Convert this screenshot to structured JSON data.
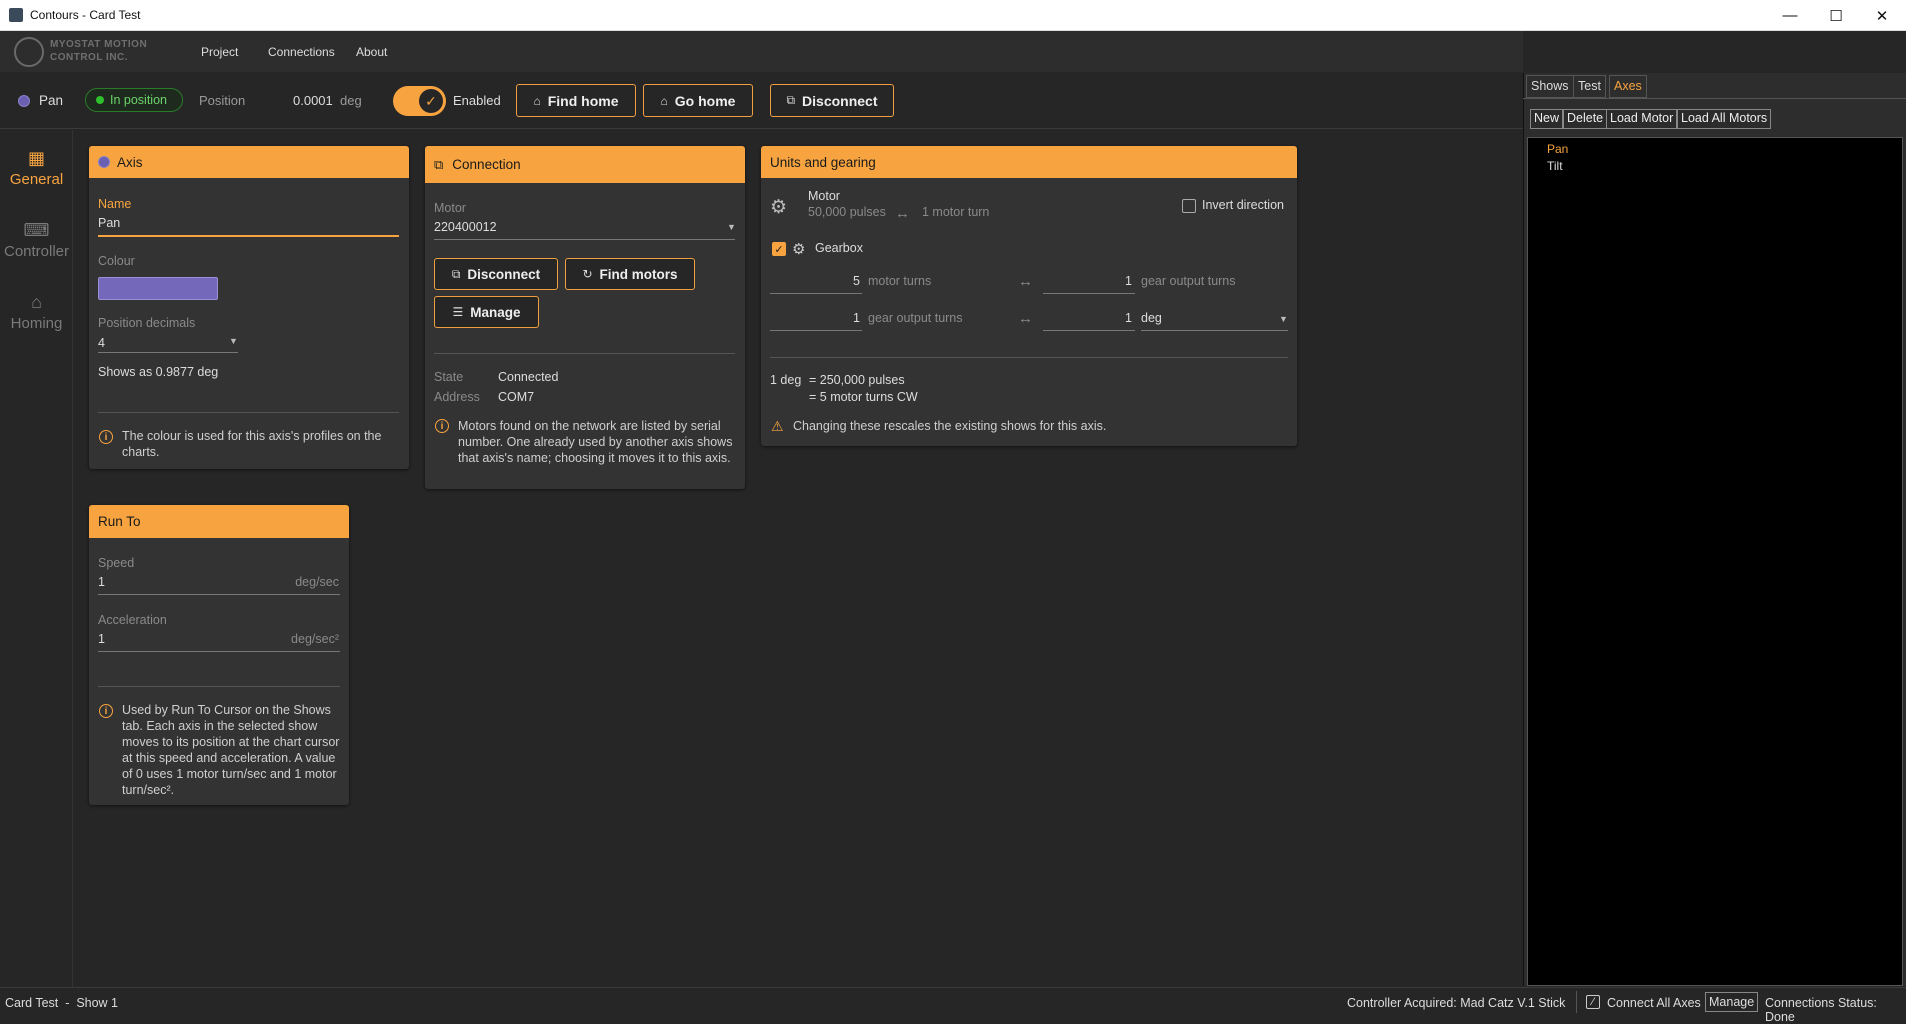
{
  "window": {
    "title": "Contours - Card Test",
    "min": "—",
    "max": "☐",
    "close": "✕"
  },
  "logo": {
    "line1": "MYOSTAT MOTION",
    "line2": "CONTROL INC."
  },
  "menu": {
    "project": "Project",
    "connections": "Connections",
    "about": "About"
  },
  "toolbar": {
    "axis_name": "Pan",
    "status": "In position",
    "position_label": "Position",
    "position_value": "0.0001",
    "position_unit": "deg",
    "enabled_label": "Enabled",
    "find_home": "Find home",
    "go_home": "Go home",
    "disconnect": "Disconnect"
  },
  "nav": {
    "general": "General",
    "controller": "Controller",
    "homing": "Homing"
  },
  "axis_card": {
    "title": "Axis",
    "name_label": "Name",
    "name_value": "Pan",
    "colour_label": "Colour",
    "colour_value": "#6a5fb0",
    "decimals_label": "Position decimals",
    "decimals_value": "4",
    "shows_as": "Shows as 0.9877 deg",
    "note": "The colour is used for this axis's profiles on the charts."
  },
  "connection_card": {
    "title": "Connection",
    "motor_label": "Motor",
    "motor_value": "220400012",
    "disconnect": "Disconnect",
    "find_motors": "Find motors",
    "manage": "Manage",
    "state_label": "State",
    "state_value": "Connected",
    "address_label": "Address",
    "address_value": "COM7",
    "note": "Motors found on the network are listed by serial number. One already used by another axis shows that axis's name; choosing it moves it to this axis."
  },
  "units_card": {
    "title": "Units and gearing",
    "motor_label": "Motor",
    "pulses": "50,000 pulses",
    "arrow": "↔",
    "motor_turn": "1 motor turn",
    "invert": "Invert direction",
    "gearbox": "Gearbox",
    "row1_left": "5",
    "row1_left_unit": "motor turns",
    "row1_right": "1",
    "row1_right_unit": "gear output turns",
    "row2_left": "1",
    "row2_left_unit": "gear output turns",
    "row2_right": "1",
    "row2_right_unit": "deg",
    "sum_label": "1 deg",
    "sum1": "= 250,000 pulses",
    "sum2": "= 5 motor turns CW",
    "warning": "Changing these rescales the existing shows for this axis."
  },
  "runto_card": {
    "title": "Run To",
    "speed_label": "Speed",
    "speed_value": "1",
    "speed_unit": "deg/sec",
    "accel_label": "Acceleration",
    "accel_value": "1",
    "accel_unit": "deg/sec²",
    "note": "Used by Run To Cursor on the Shows tab. Each axis in the selected show moves to its position at the chart cursor at this speed and acceleration. A value of 0 uses 1 motor turn/sec and 1 motor turn/sec²."
  },
  "right": {
    "tabs": [
      "Shows",
      "Test",
      "Axes"
    ],
    "buttons": [
      "New",
      "Delete",
      "Load Motor",
      "Load All Motors"
    ],
    "items": [
      "Pan",
      "Tilt"
    ]
  },
  "status": {
    "left": "Card Test  -  Show 1",
    "controller": "Controller Acquired: Mad Catz V.1 Stick",
    "connect_all": "Connect All Axes",
    "manage": "Manage",
    "conn_status": "Connections Status: Done"
  },
  "colors": {
    "accent": "#f7a440",
    "axis": "#6a5fb0",
    "ok": "#2fbf2f"
  }
}
